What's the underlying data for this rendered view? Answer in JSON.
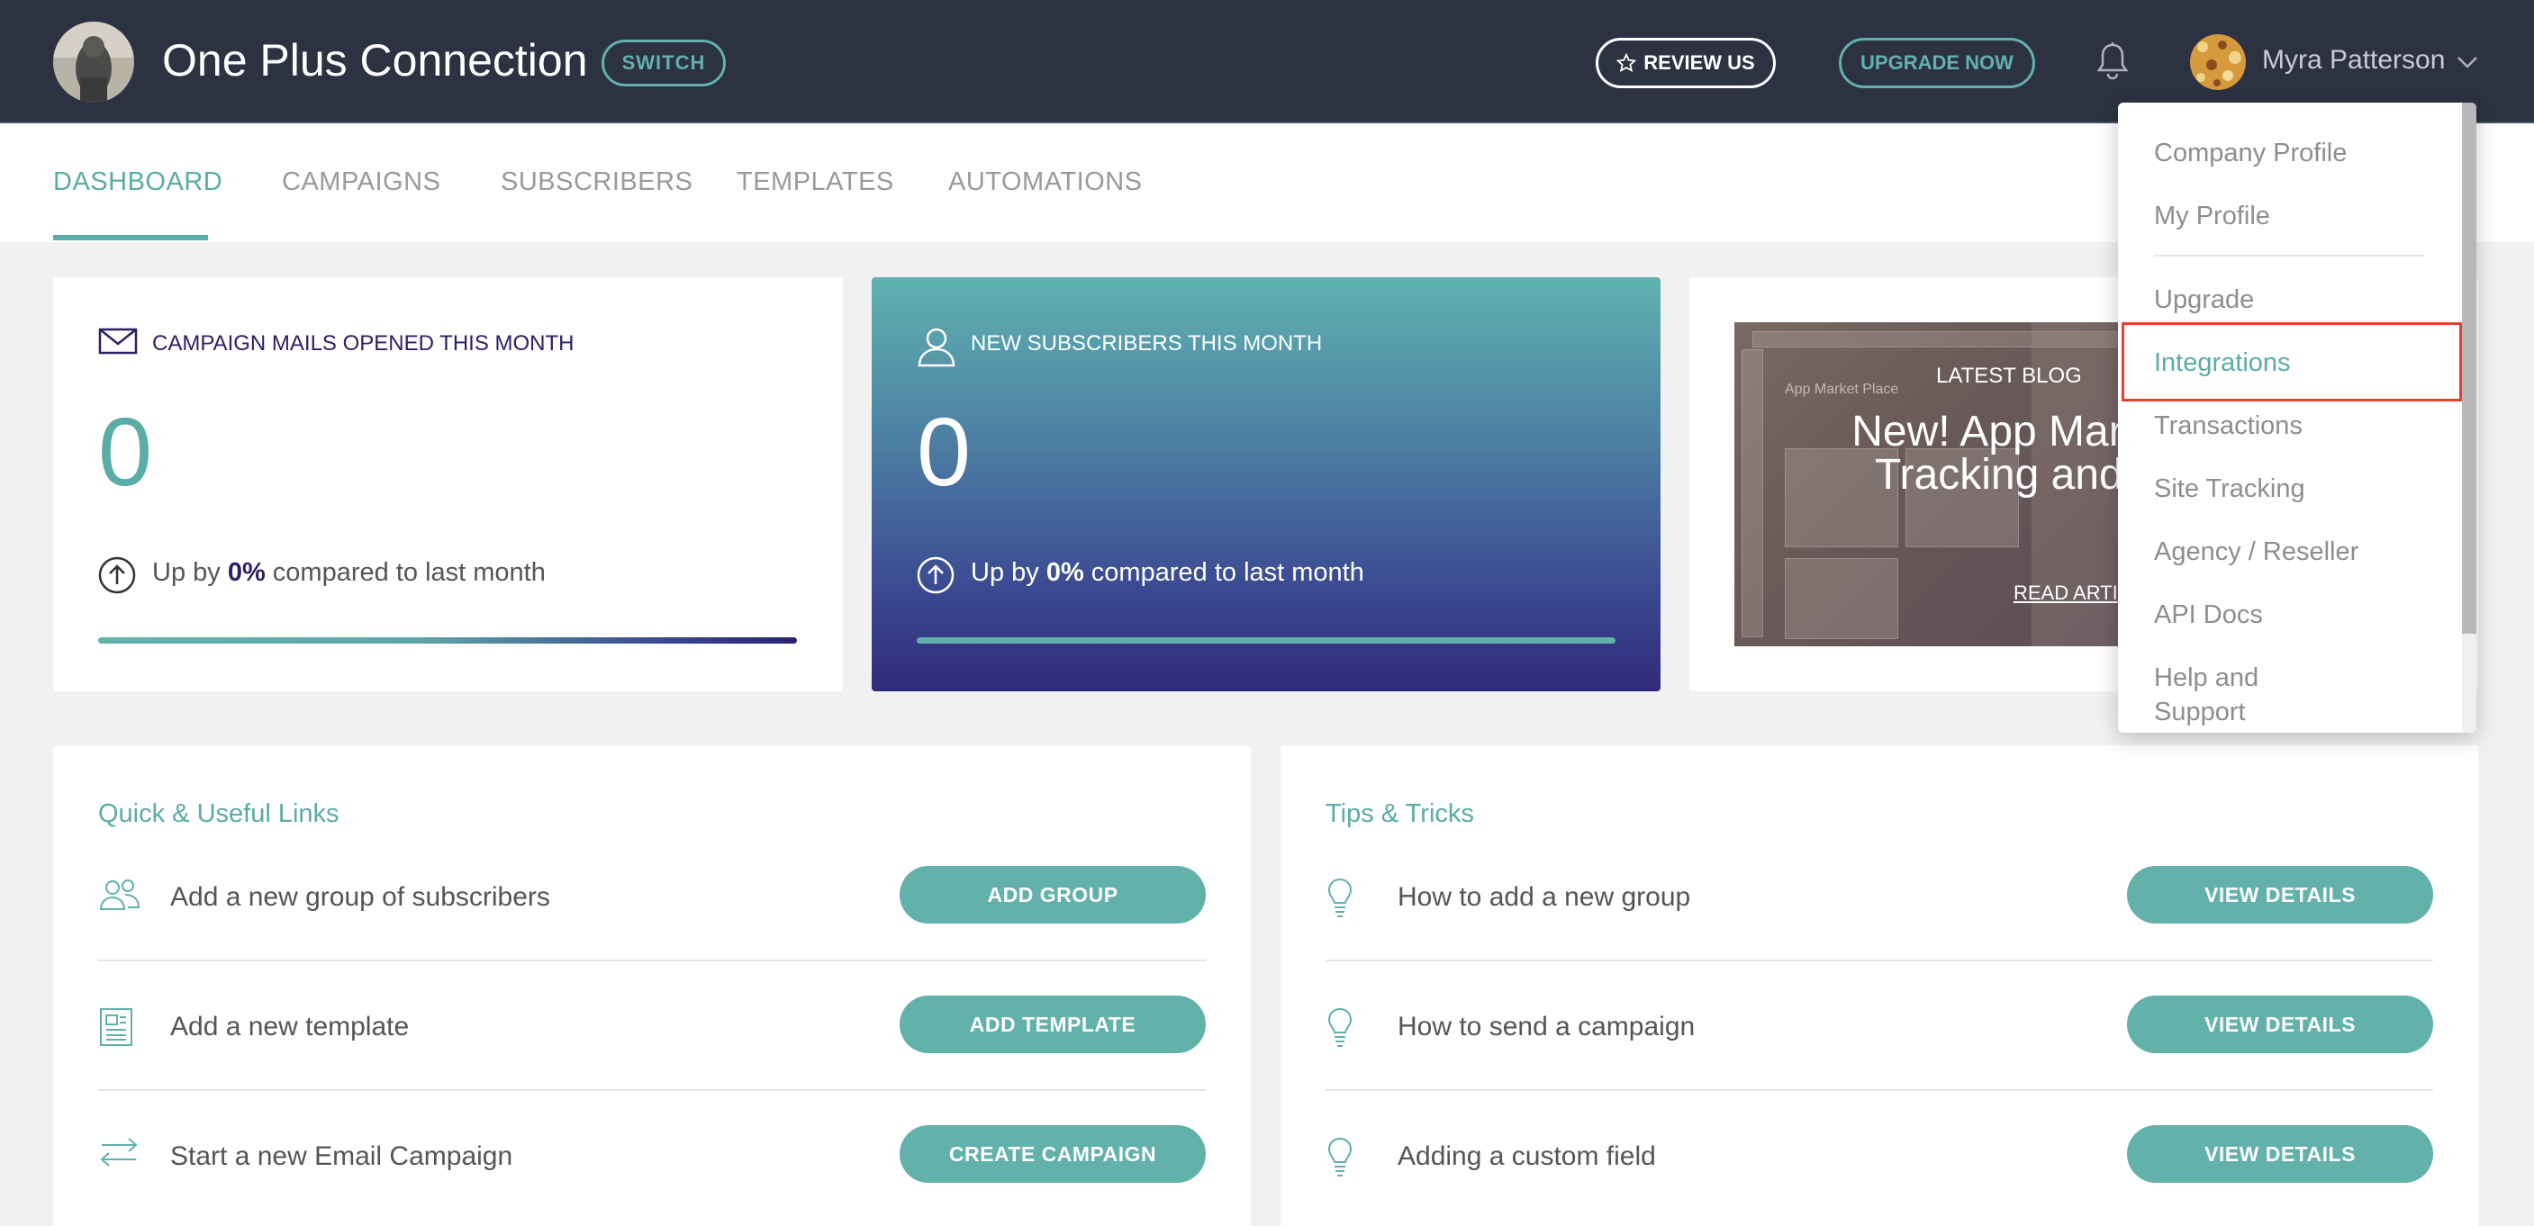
{
  "header": {
    "company_name": "One Plus Connection",
    "switch_label": "SWITCH",
    "review_label": "REVIEW US",
    "upgrade_label": "UPGRADE NOW",
    "user_name": "Myra Patterson"
  },
  "nav": {
    "tabs": [
      {
        "label": "DASHBOARD",
        "active": true
      },
      {
        "label": "CAMPAIGNS",
        "active": false
      },
      {
        "label": "SUBSCRIBERS",
        "active": false
      },
      {
        "label": "TEMPLATES",
        "active": false
      },
      {
        "label": "AUTOMATIONS",
        "active": false
      }
    ]
  },
  "stats": [
    {
      "title": "CAMPAIGN MAILS OPENED THIS MONTH",
      "value": "0",
      "compare_prefix": "Up by ",
      "compare_value": "0%",
      "compare_suffix": " compared to last month",
      "icon": "envelope-icon"
    },
    {
      "title": "NEW SUBSCRIBERS THIS MONTH",
      "value": "0",
      "compare_prefix": "Up by ",
      "compare_value": "0%",
      "compare_suffix": " compared to last month",
      "icon": "user-icon"
    }
  ],
  "blog": {
    "label": "LATEST BLOG",
    "title_line1": "New! App Mar",
    "title_line2": "Tracking and",
    "read_label": "READ ARTI",
    "mock_header": "App Market Place"
  },
  "quick_links": {
    "heading": "Quick & Useful Links",
    "rows": [
      {
        "text": "Add a new group of subscribers",
        "button": "ADD GROUP",
        "icon": "users-icon"
      },
      {
        "text": "Add a new template",
        "button": "ADD TEMPLATE",
        "icon": "template-icon"
      },
      {
        "text": "Start a new Email Campaign",
        "button": "CREATE CAMPAIGN",
        "icon": "arrows-icon"
      }
    ]
  },
  "tips": {
    "heading": "Tips & Tricks",
    "rows": [
      {
        "text": "How to add a new group",
        "button": "VIEW DETAILS",
        "icon": "lightbulb-icon"
      },
      {
        "text": "How to send a campaign",
        "button": "VIEW DETAILS",
        "icon": "lightbulb-icon"
      },
      {
        "text": "Adding a custom field",
        "button": "VIEW DETAILS",
        "icon": "lightbulb-icon"
      }
    ]
  },
  "dropdown": {
    "items": [
      "Company Profile",
      "My Profile",
      "Upgrade",
      "Integrations",
      "Transactions",
      "Site Tracking",
      "Agency / Reseller",
      "API Docs",
      "Help and",
      "Support"
    ],
    "highlighted": "Integrations"
  },
  "colors": {
    "topbar": "#2c3241",
    "accent": "#5aaca6",
    "highlight_border": "#e0452c",
    "dark_text": "#2a2266"
  }
}
